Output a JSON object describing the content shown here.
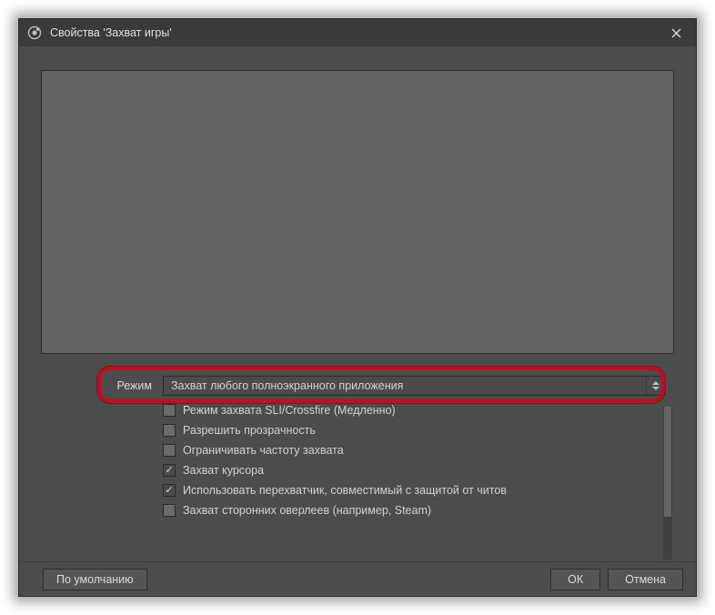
{
  "window": {
    "title": "Свойства 'Захват игры'"
  },
  "form": {
    "mode_label": "Режим",
    "mode_value": "Захват любого полноэкранного приложения",
    "checks": [
      {
        "label": "Режим захвата SLI/Crossfire (Медленно)",
        "checked": false
      },
      {
        "label": "Разрешить прозрачность",
        "checked": false
      },
      {
        "label": "Ограничивать частоту захвата",
        "checked": false
      },
      {
        "label": "Захват курсора",
        "checked": true
      },
      {
        "label": "Использовать перехватчик, совместимый с защитой от читов",
        "checked": true
      },
      {
        "label": "Захват сторонних оверлеев (например, Steam)",
        "checked": false
      }
    ]
  },
  "footer": {
    "defaults": "По умолчанию",
    "ok": "ОК",
    "cancel": "Отмена"
  }
}
